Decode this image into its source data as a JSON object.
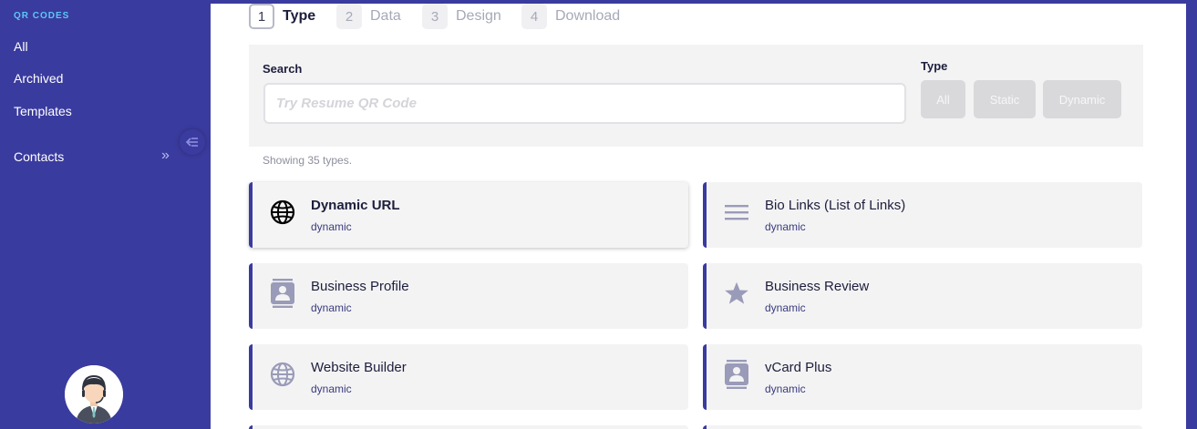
{
  "sidebar": {
    "section_label": "QR CODES",
    "items": [
      {
        "label": "All"
      },
      {
        "label": "Archived"
      },
      {
        "label": "Templates"
      },
      {
        "label": "Contacts"
      }
    ],
    "contacts_chevron": "»"
  },
  "steps": [
    {
      "num": "1",
      "label": "Type"
    },
    {
      "num": "2",
      "label": "Data"
    },
    {
      "num": "3",
      "label": "Design"
    },
    {
      "num": "4",
      "label": "Download"
    }
  ],
  "filter": {
    "search_label": "Search",
    "search_placeholder": "Try Resume QR Code",
    "search_value": "",
    "type_label": "Type",
    "type_options": [
      "All",
      "Static",
      "Dynamic"
    ]
  },
  "showing_text": "Showing 35 types.",
  "cards": [
    {
      "title": "Dynamic URL",
      "sub": "dynamic",
      "icon": "globe-icon"
    },
    {
      "title": "Bio Links (List of Links)",
      "sub": "dynamic",
      "icon": "list-icon"
    },
    {
      "title": "Business Profile",
      "sub": "dynamic",
      "icon": "contact-card-icon"
    },
    {
      "title": "Business Review",
      "sub": "dynamic",
      "icon": "star-icon"
    },
    {
      "title": "Website Builder",
      "sub": "dynamic",
      "icon": "globe-icon"
    },
    {
      "title": "vCard Plus",
      "sub": "dynamic",
      "icon": "contact-card-icon"
    }
  ],
  "colors": {
    "sidebar_bg": "#3a3b9e",
    "accent_label": "#5bc8f5",
    "card_border": "#3a3b9e",
    "icon_muted": "#9a9bb8"
  }
}
